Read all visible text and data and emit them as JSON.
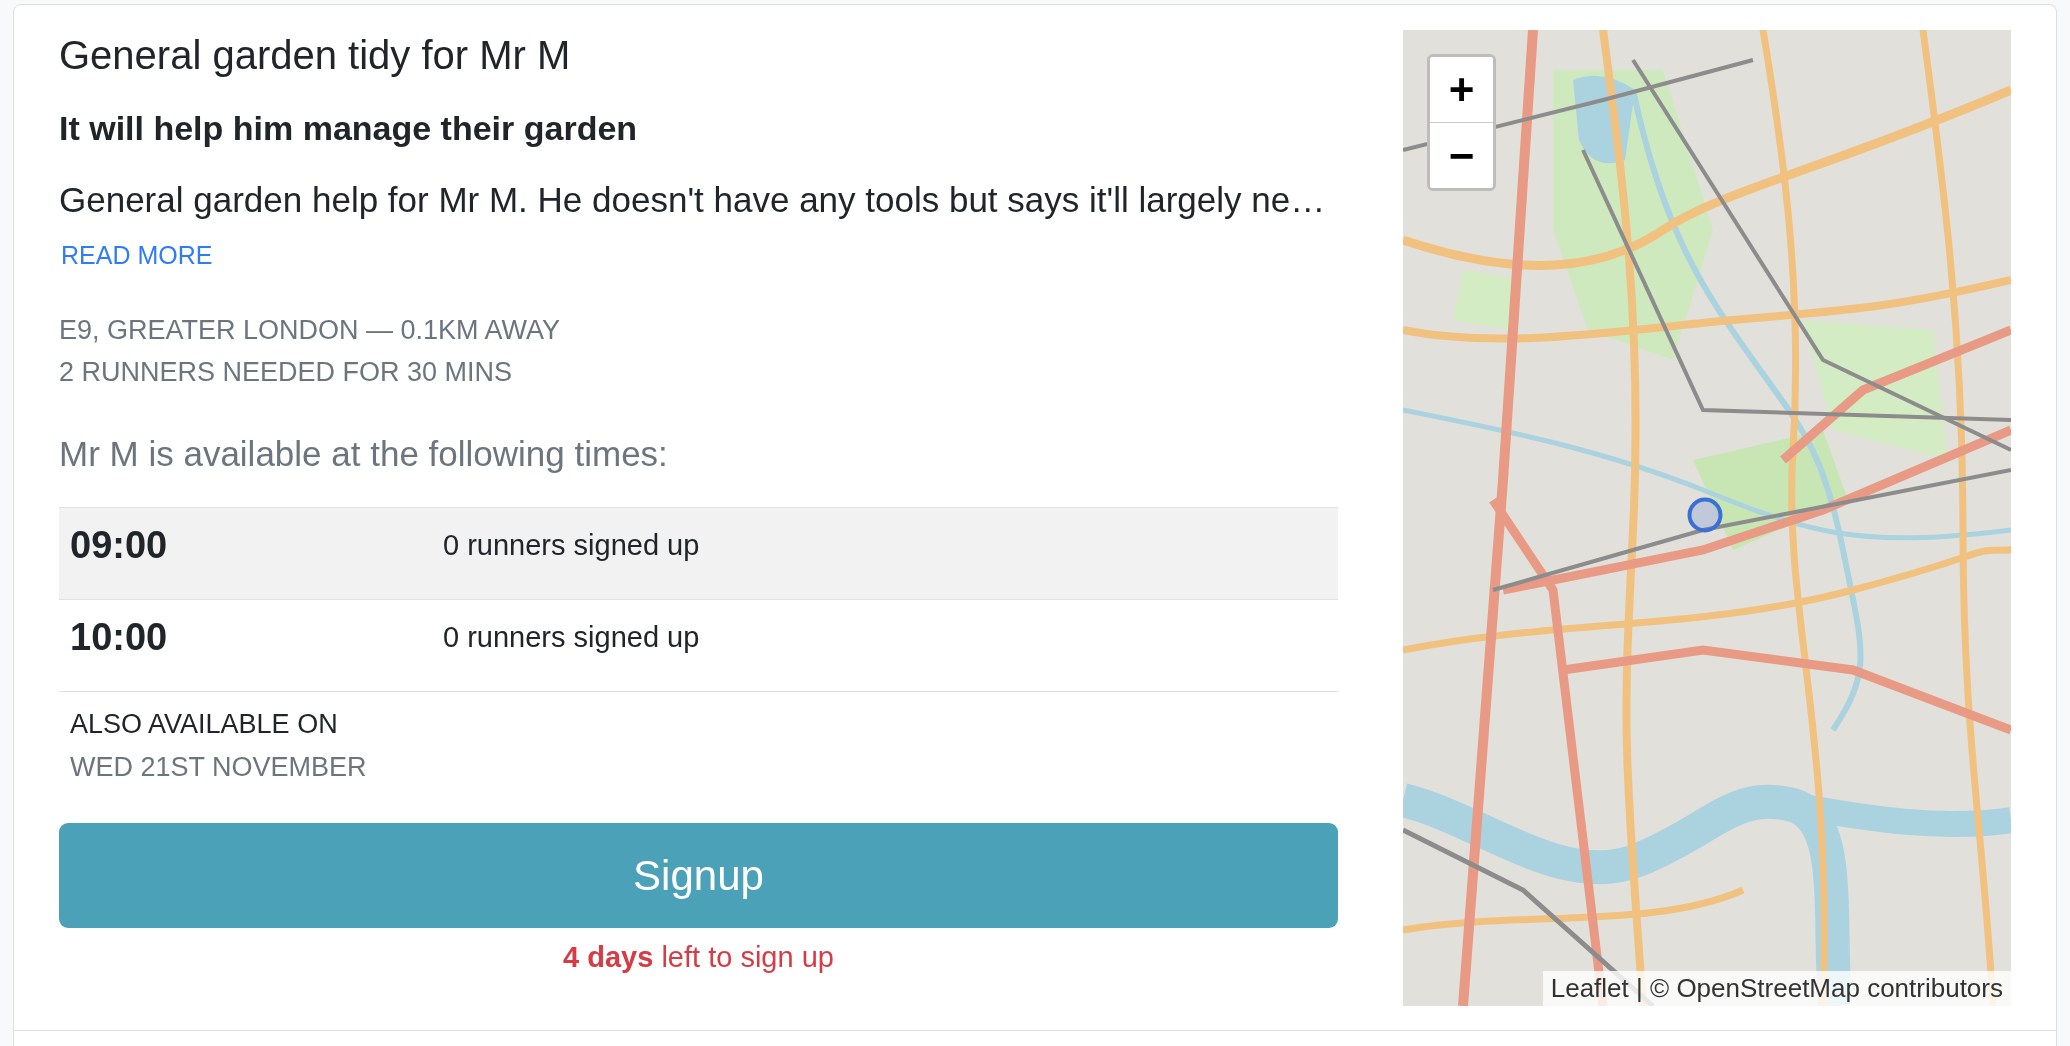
{
  "listing": {
    "title": "General garden tidy for Mr M",
    "subtitle": "It will help him manage their garden",
    "description": "General garden help for Mr M. He doesn't have any tools but says it'll largely ne…",
    "read_more": "READ MORE",
    "location": "E9, GREATER LONDON — 0.1KM AWAY",
    "runners_needed": "2 RUNNERS NEEDED FOR 30 MINS",
    "availability_heading": "Mr M is available at the following times:",
    "time_slots": [
      {
        "time": "09:00",
        "signups": "0 runners signed up"
      },
      {
        "time": "10:00",
        "signups": "0 runners signed up"
      }
    ],
    "also_available": {
      "label": "ALSO AVAILABLE ON",
      "dates": [
        "WED 21ST NOVEMBER"
      ]
    },
    "signup_button": "Signup",
    "deadline": "**4 days** left to sign up"
  },
  "map": {
    "zoom_in": "+",
    "zoom_out": "−",
    "attribution": "Leaflet | © OpenStreetMap contributors"
  }
}
